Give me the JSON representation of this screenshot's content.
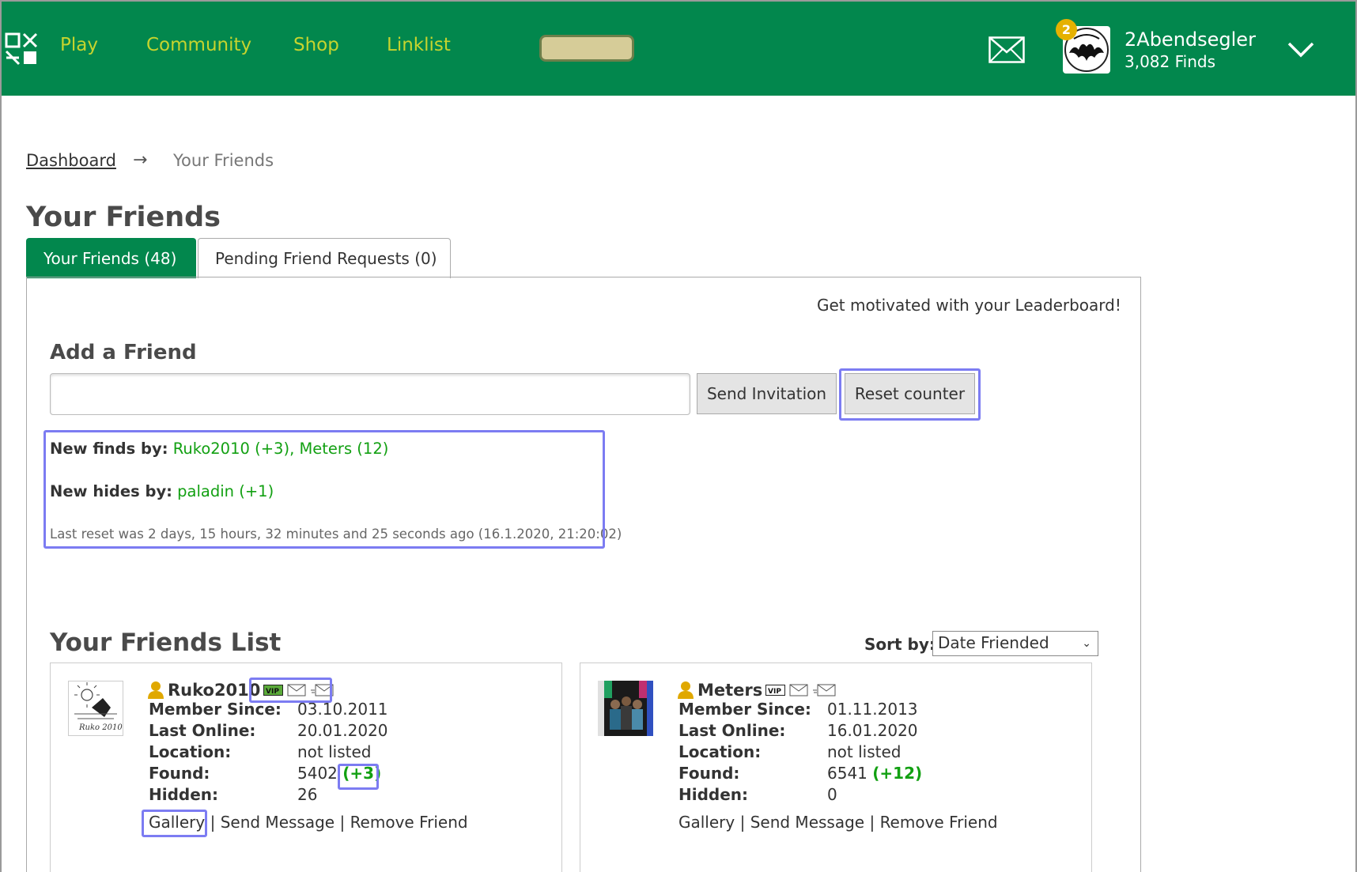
{
  "header": {
    "nav": [
      "Play",
      "Community",
      "Shop",
      "Linklist"
    ],
    "notification_count": "2",
    "username": "2Abendsegler",
    "finds": "3,082 Finds",
    "colors": {
      "bar": "#02874d",
      "nav_text": "#c6d42e",
      "badge": "#e5b100"
    }
  },
  "breadcrumb": {
    "home": "Dashboard",
    "arrow": "→",
    "current": "Your Friends"
  },
  "page_title": "Your Friends",
  "tabs": [
    {
      "label": "Your Friends (48)",
      "active": true
    },
    {
      "label": "Pending Friend Requests (0)",
      "active": false
    }
  ],
  "leaderboard_link": "Get motivated with your Leaderboard!",
  "add_friend": {
    "title": "Add a Friend",
    "input_value": "",
    "send_label": "Send Invitation",
    "reset_label": "Reset counter"
  },
  "news": {
    "finds_label": "New finds by:",
    "finds_value": "Ruko2010 (+3), Meters (12)",
    "hides_label": "New hides by:",
    "hides_value": "paladin (+1)",
    "reset_note": "Last reset was 2 days, 15 hours, 32 minutes and 25 seconds ago (16.1.2020, 21:20:02)"
  },
  "friends_list": {
    "title": "Your Friends List",
    "sort_label": "Sort by:",
    "sort_value": "Date Friended",
    "labels": {
      "member_since": "Member Since:",
      "last_online": "Last Online:",
      "location": "Location:",
      "found": "Found:",
      "hidden": "Hidden:"
    },
    "link_labels": {
      "gallery": "Gallery",
      "sep": "|",
      "message": "Send Message",
      "remove": "Remove Friend"
    },
    "friends": [
      {
        "name": "Ruko2010",
        "member_since": "03.10.2011",
        "last_online": "20.01.2020",
        "location": "not listed",
        "found": "5402",
        "found_delta": "(+3)",
        "hidden": "26",
        "avatar_caption": "Ruko 2010"
      },
      {
        "name": "Meters",
        "member_since": "01.11.2013",
        "last_online": "16.01.2020",
        "location": "not listed",
        "found": "6541",
        "found_delta": "(+12)",
        "hidden": "0"
      }
    ]
  }
}
